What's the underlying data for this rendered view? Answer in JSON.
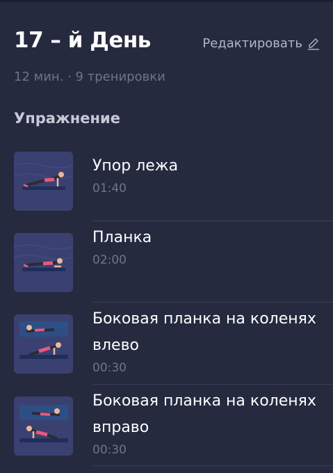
{
  "header": {
    "title": "17 – й День",
    "edit_label": "Редактировать",
    "edit_icon": "pencil-icon"
  },
  "meta": "12 мин. · 9 тренировки",
  "section_title": "Упражнение",
  "exercises": [
    {
      "name": "Упор лежа",
      "time": "01:40",
      "thumb": "push-up-pose"
    },
    {
      "name": "Планка",
      "time": "02:00",
      "thumb": "plank-pose"
    },
    {
      "name": "Боковая планка на коленях влево",
      "time": "00:30",
      "thumb": "side-plank-left-pose"
    },
    {
      "name": "Боковая планка на коленях вправо",
      "time": "00:30",
      "thumb": "side-plank-right-pose"
    }
  ],
  "colors": {
    "background": "#252a3f",
    "muted_text": "#6f7489",
    "thumb_bg": "#3a4170",
    "accent_pink": "#e8587f"
  }
}
